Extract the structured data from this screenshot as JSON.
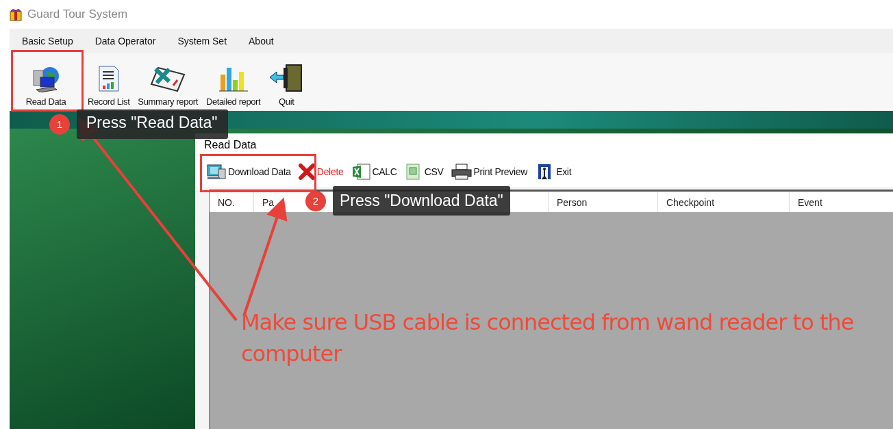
{
  "window": {
    "title": "Guard Tour System"
  },
  "menu": [
    "Basic Setup",
    "Data Operator",
    "System Set",
    "About"
  ],
  "toolbar": [
    "Read Data",
    "Record List",
    "Summary report",
    "Detailed report",
    "Quit"
  ],
  "child_window": {
    "title": "Read Data",
    "toolbar": [
      {
        "label": "Download Data",
        "kind": "normal"
      },
      {
        "label": "Delete",
        "kind": "danger"
      },
      {
        "label": "CALC",
        "kind": "normal"
      },
      {
        "label": "CSV",
        "kind": "normal"
      },
      {
        "label": "Print Preview",
        "kind": "normal"
      },
      {
        "label": "Exit",
        "kind": "normal"
      }
    ],
    "table": {
      "columns": [
        "NO.",
        "Pa",
        "",
        "Person",
        "Checkpoint",
        "Event"
      ]
    }
  },
  "annotations": {
    "callouts": [
      {
        "number": "1",
        "text": "Press \"Read Data\""
      },
      {
        "number": "2",
        "text": "Press \"Download Data\""
      }
    ],
    "note": "Make sure USB cable is connected from wand reader to the computer"
  }
}
